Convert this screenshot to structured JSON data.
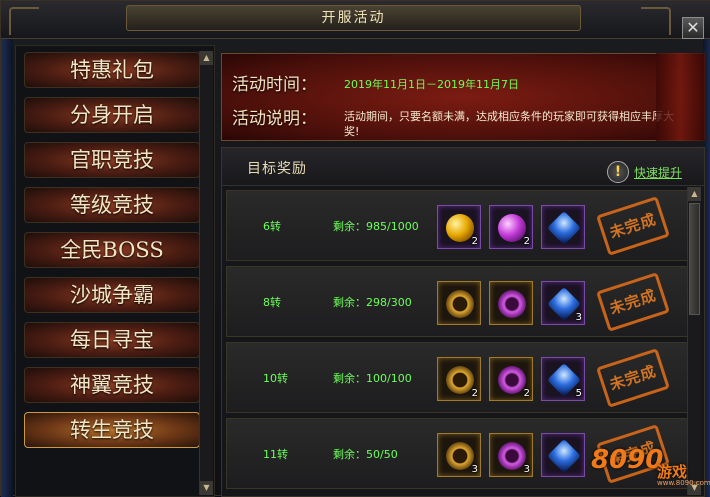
{
  "window": {
    "title": "开服活动",
    "close_symbol": "✕"
  },
  "sidebar": {
    "items": [
      {
        "label": "特惠礼包",
        "active": false
      },
      {
        "label": "分身开启",
        "active": false
      },
      {
        "label": "官职竞技",
        "active": false
      },
      {
        "label": "等级竞技",
        "active": false
      },
      {
        "label": "全民BOSS",
        "active": false
      },
      {
        "label": "沙城争霸",
        "active": false
      },
      {
        "label": "每日寻宝",
        "active": false
      },
      {
        "label": "神翼竞技",
        "active": false
      },
      {
        "label": "转生竞技",
        "active": true
      }
    ]
  },
  "banner": {
    "time_label": "活动时间：",
    "time_value": "2019年11月1日－2019年11月7日",
    "desc_label": "活动说明：",
    "desc_value": "活动期间，只要名额未满，达成相应条件的玩家即可获得相应丰厚大奖!"
  },
  "rewards": {
    "title": "目标奖励",
    "info_icon": "!",
    "quick_link": "快速提升",
    "rows": [
      {
        "level": "6转",
        "remaining": "剩余：985/1000",
        "status": "未完成",
        "items": [
          {
            "icon": "gold-orb-icon",
            "count": "2"
          },
          {
            "icon": "purple-orb-icon",
            "count": "2"
          },
          {
            "icon": "blue-gem-icon",
            "count": ""
          }
        ]
      },
      {
        "level": "8转",
        "remaining": "剩余：298/300",
        "status": "未完成",
        "items": [
          {
            "icon": "gold-ring-icon",
            "count": ""
          },
          {
            "icon": "purple-ring-icon",
            "count": ""
          },
          {
            "icon": "blue-gem-icon",
            "count": "3"
          }
        ]
      },
      {
        "level": "10转",
        "remaining": "剩余：100/100",
        "status": "未完成",
        "items": [
          {
            "icon": "gold-ring-icon",
            "count": "2"
          },
          {
            "icon": "purple-ring-icon",
            "count": "2"
          },
          {
            "icon": "blue-gem-icon",
            "count": "5"
          }
        ]
      },
      {
        "level": "11转",
        "remaining": "剩余：50/50",
        "status": "未完成",
        "items": [
          {
            "icon": "gold-ring-icon",
            "count": "3"
          },
          {
            "icon": "purple-ring-icon",
            "count": "3"
          },
          {
            "icon": "blue-gem-icon",
            "count": ""
          }
        ]
      }
    ]
  },
  "watermark": {
    "number": "8090",
    "text": "游戏",
    "url": "www.8090.com"
  }
}
